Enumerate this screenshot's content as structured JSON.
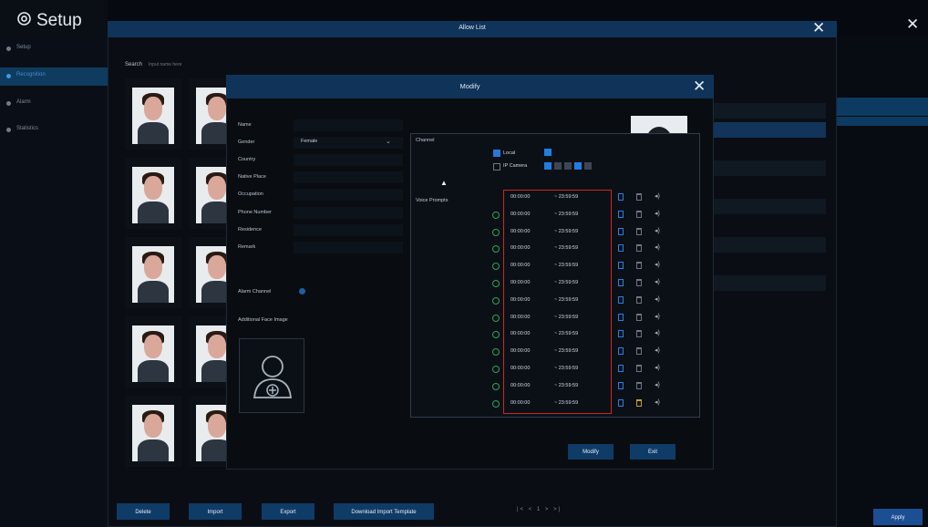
{
  "app": {
    "title": "Setup",
    "icon": "gear-icon"
  },
  "sidebar": {
    "items": [
      {
        "label": "Setup",
        "active": false
      },
      {
        "label": "Recognition",
        "active": true
      },
      {
        "label": "Alarm",
        "active": false
      },
      {
        "label": "Statistics",
        "active": false
      }
    ]
  },
  "allow_list": {
    "title": "Allow List",
    "search_label": "Search",
    "search_placeholder": "Input name here",
    "bottom_buttons": [
      "Delete",
      "Import",
      "Export",
      "Download Import Template"
    ],
    "pagination": "|< <   1   >  >|",
    "apply_label": "Apply"
  },
  "modify": {
    "title": "Modify",
    "fields": [
      {
        "label": "Name"
      },
      {
        "label": "Gender",
        "value": "Female"
      },
      {
        "label": "Country"
      },
      {
        "label": "Native Place"
      },
      {
        "label": "Occupation"
      },
      {
        "label": "Phone Number"
      },
      {
        "label": "Residence"
      },
      {
        "label": "Remark"
      },
      {
        "label": "Alarm Channel"
      }
    ],
    "additional_face_label": "Additional Face Image",
    "ok_label": "Modify",
    "exit_label": "Exit"
  },
  "channel_popup": {
    "channel_label": "Channel",
    "local_label": "Local",
    "ip_camera_label": "IP Camera",
    "voice_prompts_label": "Voice Prompts",
    "voice_prompts": [
      {
        "start": "00:00:00",
        "end": "~ 23:59:59"
      },
      {
        "start": "00:00:00",
        "end": "~ 23:59:59"
      },
      {
        "start": "00:00:00",
        "end": "~ 23:59:59"
      },
      {
        "start": "00:00:00",
        "end": "~ 23:59:59"
      },
      {
        "start": "00:00:00",
        "end": "~ 23:59:59"
      },
      {
        "start": "00:00:00",
        "end": "~ 23:59:59"
      },
      {
        "start": "00:00:00",
        "end": "~ 23:59:59"
      },
      {
        "start": "00:00:00",
        "end": "~ 23:59:59"
      },
      {
        "start": "00:00:00",
        "end": "~ 23:59:59"
      },
      {
        "start": "00:00:00",
        "end": "~ 23:59:59"
      },
      {
        "start": "00:00:00",
        "end": "~ 23:59:59"
      },
      {
        "start": "00:00:00",
        "end": "~ 23:59:59"
      },
      {
        "start": "00:00:00",
        "end": "~ 23:59:59"
      }
    ]
  },
  "colors": {
    "accent": "#10335a",
    "highlight": "#d3261e",
    "primary_button": "#0f3b67"
  }
}
